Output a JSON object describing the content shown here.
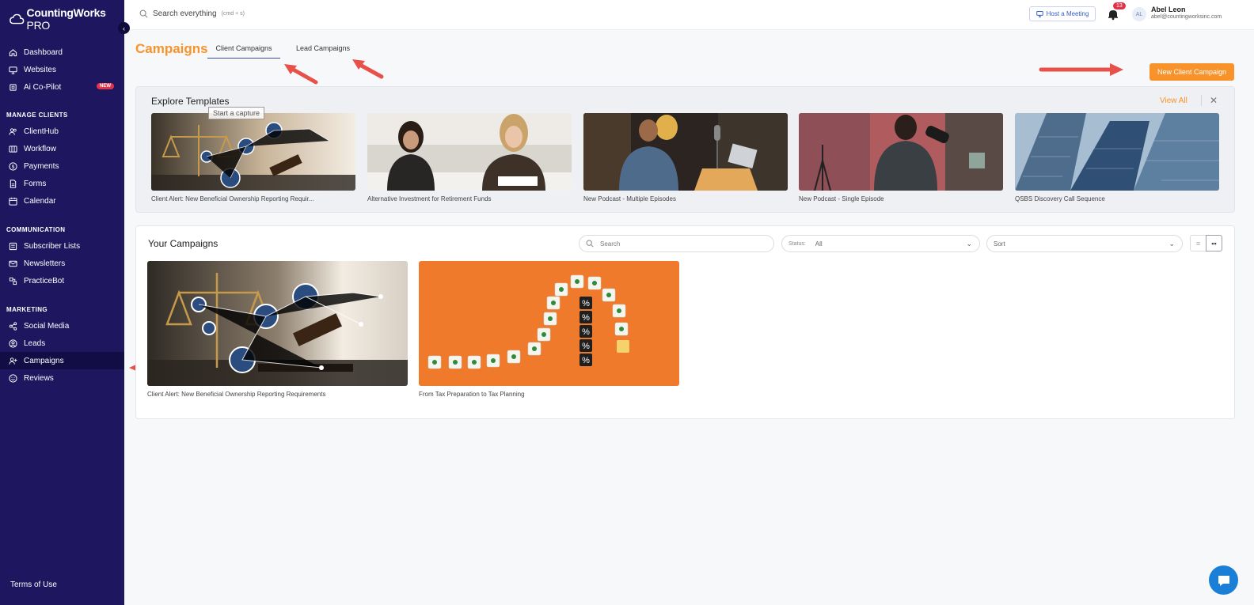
{
  "app": {
    "brand": "CountingWorks",
    "brand_suffix": " PRO"
  },
  "sidebar": {
    "top_items": [
      {
        "label": "Dashboard",
        "icon": "home-icon"
      },
      {
        "label": "Websites",
        "icon": "monitor-icon"
      },
      {
        "label": "Ai Co-Pilot",
        "icon": "cpu-icon",
        "badge": "NEW"
      }
    ],
    "sections": [
      {
        "title": "MANAGE CLIENTS",
        "items": [
          {
            "label": "ClientHub",
            "icon": "users-icon"
          },
          {
            "label": "Workflow",
            "icon": "columns-icon"
          },
          {
            "label": "Payments",
            "icon": "dollar-icon"
          },
          {
            "label": "Forms",
            "icon": "file-icon"
          },
          {
            "label": "Calendar",
            "icon": "calendar-icon"
          }
        ]
      },
      {
        "title": "COMMUNICATION",
        "items": [
          {
            "label": "Subscriber Lists",
            "icon": "list-icon"
          },
          {
            "label": "Newsletters",
            "icon": "mail-icon"
          },
          {
            "label": "PracticeBot",
            "icon": "bot-icon"
          }
        ]
      },
      {
        "title": "MARKETING",
        "items": [
          {
            "label": "Social Media",
            "icon": "share-icon"
          },
          {
            "label": "Leads",
            "icon": "user-circle-icon"
          },
          {
            "label": "Campaigns",
            "icon": "user-plus-icon",
            "active": true
          },
          {
            "label": "Reviews",
            "icon": "smile-icon"
          }
        ]
      }
    ],
    "terms": "Terms of Use"
  },
  "topbar": {
    "search_label": "Search everything",
    "search_hint": "(cmd + s)",
    "host_meeting": "Host a Meeting",
    "notification_count": "13",
    "avatar_initials": "AL",
    "user_name": "Abel Leon",
    "user_email": "abel@countingworksinc.com"
  },
  "page": {
    "title": "Campaigns",
    "tabs": [
      {
        "label": "Client Campaigns",
        "active": true
      },
      {
        "label": "Lead Campaigns"
      }
    ],
    "new_button": "New Client Campaign"
  },
  "explore": {
    "title": "Explore Templates",
    "view_all": "View All",
    "close": "✕",
    "tooltip": "Start a capture",
    "templates": [
      {
        "label": "Client Alert: New Beneficial Ownership Reporting Requir..."
      },
      {
        "label": "Alternative Investment for Retirement Funds"
      },
      {
        "label": "New Podcast - Multiple Episodes"
      },
      {
        "label": "New Podcast - Single Episode"
      },
      {
        "label": "QSBS Discovery Call Sequence"
      }
    ]
  },
  "campaigns": {
    "title": "Your Campaigns",
    "search_placeholder": "Search",
    "status_label": "Status:",
    "status_value": "All",
    "sort_value": "Sort",
    "items": [
      {
        "label": "Client Alert: New Beneficial Ownership Reporting Requirements"
      },
      {
        "label": "From Tax Preparation to Tax Planning"
      }
    ]
  },
  "colors": {
    "sidebar": "#1e1760",
    "accent": "#f7932a",
    "arrow": "#e8504a",
    "link": "#3561c7"
  }
}
